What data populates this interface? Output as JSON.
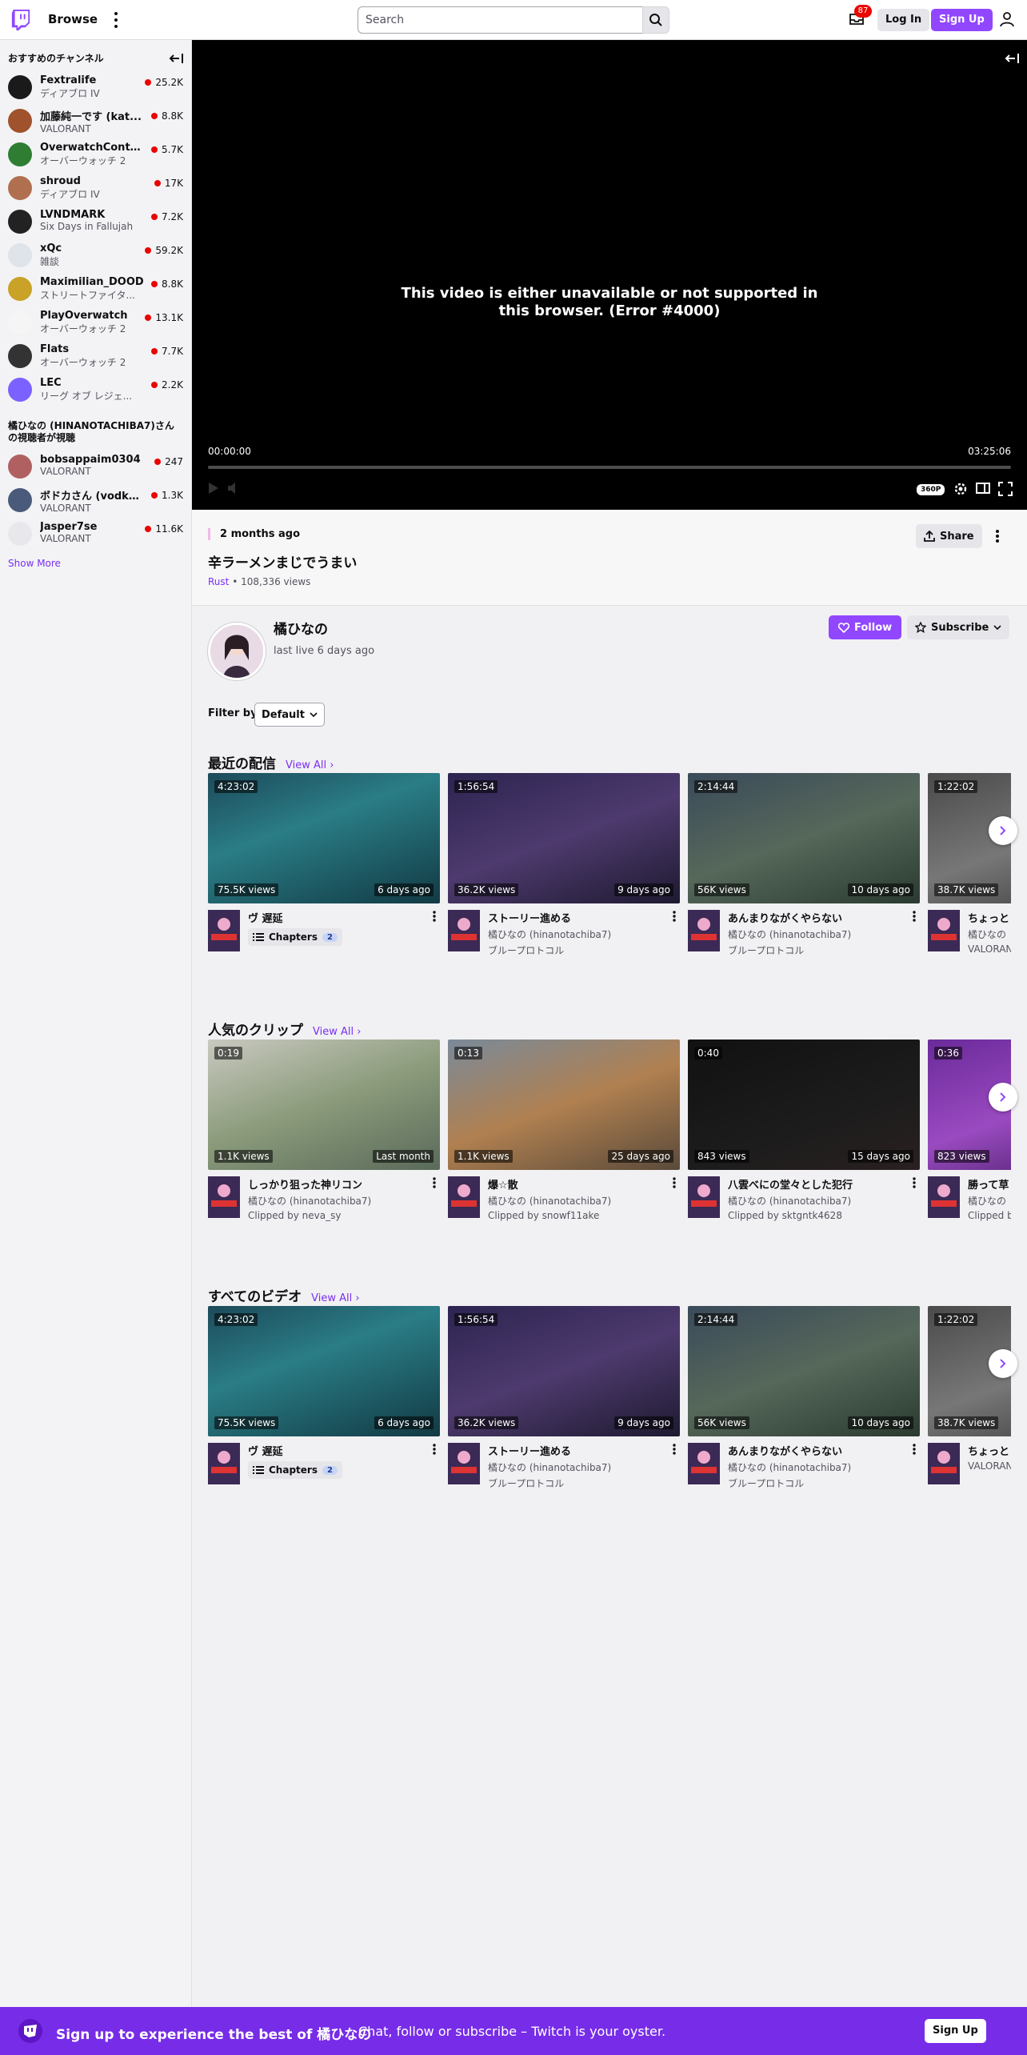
{
  "nav": {
    "browse": "Browse",
    "search_placeholder": "Search",
    "notifications_count": "87",
    "login": "Log In",
    "signup": "Sign Up"
  },
  "sidebar": {
    "recommended_title": "おすすめのチャンネル",
    "channels": [
      {
        "name": "Fextralife",
        "game": "ディアブロ IV",
        "viewers": "25.2K",
        "color": "#1a1a1a"
      },
      {
        "name": "加藤純一です (kat...",
        "game": "VALORANT",
        "viewers": "8.8K",
        "color": "#a0522d"
      },
      {
        "name": "OverwatchConte...",
        "game": "オーバーウォッチ 2",
        "viewers": "5.7K",
        "color": "#2e7d32"
      },
      {
        "name": "shroud",
        "game": "ディアブロ IV",
        "viewers": "17K",
        "color": "#b07050"
      },
      {
        "name": "LVNDMARK",
        "game": "Six Days in Fallujah",
        "viewers": "7.2K",
        "color": "#222"
      },
      {
        "name": "xQc",
        "game": "雑談",
        "viewers": "59.2K",
        "color": "#dfe3ea"
      },
      {
        "name": "Maximilian_DOOD",
        "game": "ストリートファイタ...",
        "viewers": "8.8K",
        "color": "#c9a227"
      },
      {
        "name": "PlayOverwatch",
        "game": "オーバーウォッチ 2",
        "viewers": "13.1K",
        "color": "#f5f5f5"
      },
      {
        "name": "Flats",
        "game": "オーバーウォッチ 2",
        "viewers": "7.7K",
        "color": "#333"
      },
      {
        "name": "LEC",
        "game": "リーグ オブ レジェ...",
        "viewers": "2.2K",
        "color": "#7b61ff"
      }
    ],
    "viewers_also_title": "橘ひなの (HINANOTACHIBA7)さんの視聴者が視聴",
    "also_channels": [
      {
        "name": "bobsappaim0304",
        "game": "VALORANT",
        "viewers": "247",
        "color": "#b06060"
      },
      {
        "name": "ボドカさん (vodka...",
        "game": "VALORANT",
        "viewers": "1.3K",
        "color": "#4a5a7a"
      },
      {
        "name": "Jasper7se",
        "game": "VALORANT",
        "viewers": "11.6K",
        "color": "#e8e8ec"
      }
    ],
    "show_more": "Show More"
  },
  "player": {
    "message": "This video is either unavailable or not supported in this browser. (Error #4000)",
    "current_time": "00:00:00",
    "duration": "03:25:06",
    "progress": 0,
    "quality": "360P"
  },
  "video": {
    "date": "2 months ago",
    "title": "辛ラーメンまじでうまい",
    "game": "Rust",
    "views": "108,336 views",
    "share": "Share"
  },
  "channel": {
    "name": "橘ひなの",
    "last_live": "last live 6 days ago",
    "follow": "Follow",
    "subscribe": "Subscribe"
  },
  "filter": {
    "label": "Filter by",
    "value": "Default"
  },
  "shelves": [
    {
      "title": "最近の配信",
      "view_all": "View All",
      "cards": [
        {
          "duration": "4:23:02",
          "views": "75.5K views",
          "age": "6 days ago",
          "title": "ヴ 遅延",
          "sub1": "",
          "sub2": "",
          "chapters": "Chapters",
          "chapters_n": "2",
          "bg": "linear-gradient(160deg,#1d4a5a 0%,#2a7d86 40%,#123a44 100%)"
        },
        {
          "duration": "1:56:54",
          "views": "36.2K views",
          "age": "9 days ago",
          "title": "ストーリー進める",
          "sub1": "橘ひなの (hinanotachiba7)",
          "sub2": "ブループロトコル",
          "chapters": "",
          "chapters_n": "",
          "bg": "linear-gradient(160deg,#2c2450 0%,#4e3a6e 50%,#1e1a30 100%)"
        },
        {
          "duration": "2:14:44",
          "views": "56K views",
          "age": "10 days ago",
          "title": "あんまりながくやらない",
          "sub1": "橘ひなの (hinanotachiba7)",
          "sub2": "ブループロトコル",
          "chapters": "",
          "chapters_n": "",
          "bg": "linear-gradient(160deg,#3a4a5a 0%,#56685a 50%,#2a3a30 100%)"
        },
        {
          "duration": "1:22:02",
          "views": "38.7K views",
          "age": "",
          "title": "ちょっと",
          "sub1": "橘ひなの",
          "sub2": "VALORANT",
          "chapters": "",
          "chapters_n": "",
          "bg": "linear-gradient(160deg,#4a4a4a 0%,#777 50%,#333 100%)"
        }
      ]
    },
    {
      "title": "人気のクリップ",
      "view_all": "View All",
      "cards": [
        {
          "duration": "0:19",
          "views": "1.1K views",
          "age": "Last month",
          "title": "しっかり狙った神リコン",
          "sub1": "橘ひなの (hinanotachiba7)",
          "sub2": "Clipped by neva_sy",
          "chapters": "",
          "chapters_n": "",
          "bg": "linear-gradient(160deg,#c9c9c0 0%,#8a9a7a 50%,#5a6a5a 100%)"
        },
        {
          "duration": "0:13",
          "views": "1.1K views",
          "age": "25 days ago",
          "title": "爆☆散",
          "sub1": "橘ひなの (hinanotachiba7)",
          "sub2": "Clipped by snowf11ake",
          "chapters": "",
          "chapters_n": "",
          "bg": "linear-gradient(160deg,#7a8a9a 0%,#b08050 50%,#5a4a3a 100%)"
        },
        {
          "duration": "0:40",
          "views": "843 views",
          "age": "15 days ago",
          "title": "八雲べにの堂々とした犯行",
          "sub1": "橘ひなの (hinanotachiba7)",
          "sub2": "Clipped by sktgntk4628",
          "chapters": "",
          "chapters_n": "",
          "bg": "linear-gradient(160deg,#111 0%,#1c1c1c 60%,#2a2020 100%)"
        },
        {
          "duration": "0:36",
          "views": "823 views",
          "age": "",
          "title": "勝って草",
          "sub1": "橘ひなの",
          "sub2": "Clipped b",
          "chapters": "",
          "chapters_n": "",
          "bg": "linear-gradient(160deg,#6a2a9a 0%,#9a4ac0 50%,#3a1a5a 100%)"
        }
      ]
    },
    {
      "title": "すべてのビデオ",
      "view_all": "View All",
      "cards": [
        {
          "duration": "4:23:02",
          "views": "75.5K views",
          "age": "6 days ago",
          "title": "ヴ 遅延",
          "sub1": "",
          "sub2": "",
          "chapters": "Chapters",
          "chapters_n": "2",
          "bg": "linear-gradient(160deg,#1d4a5a 0%,#2a7d86 40%,#123a44 100%)"
        },
        {
          "duration": "1:56:54",
          "views": "36.2K views",
          "age": "9 days ago",
          "title": "ストーリー進める",
          "sub1": "橘ひなの (hinanotachiba7)",
          "sub2": "ブループロトコル",
          "chapters": "",
          "chapters_n": "",
          "bg": "linear-gradient(160deg,#2c2450 0%,#4e3a6e 50%,#1e1a30 100%)"
        },
        {
          "duration": "2:14:44",
          "views": "56K views",
          "age": "10 days ago",
          "title": "あんまりながくやらない",
          "sub1": "橘ひなの (hinanotachiba7)",
          "sub2": "ブループロトコル",
          "chapters": "",
          "chapters_n": "",
          "bg": "linear-gradient(160deg,#3a4a5a 0%,#56685a 50%,#2a3a30 100%)"
        },
        {
          "duration": "1:22:02",
          "views": "38.7K views",
          "age": "",
          "title": "ちょっと",
          "sub1": "VALORAN",
          "sub2": "",
          "chapters": "",
          "chapters_n": "",
          "bg": "linear-gradient(160deg,#4a4a4a 0%,#777 50%,#333 100%)"
        }
      ]
    }
  ],
  "banner": {
    "main": "Sign up to experience the best of 橘ひなの",
    "sub": "Chat, follow or subscribe – Twitch is your oyster.",
    "button": "Sign Up"
  },
  "colors": {
    "accent": "#9147ff",
    "banner": "#772ce8",
    "live": "#eb0400"
  }
}
